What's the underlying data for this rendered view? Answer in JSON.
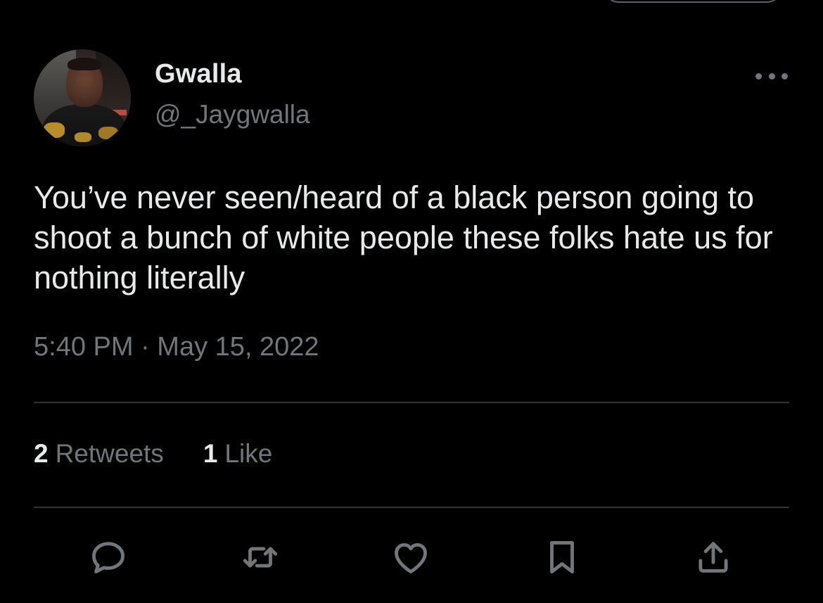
{
  "tweet": {
    "author": {
      "display_name": "Gwalla",
      "handle": "@_Jaygwalla"
    },
    "text": "You’ve never seen/heard of a black person going to shoot a bunch of white people these folks hate us for nothing literally",
    "timestamp": "5:40 PM · May 15, 2022",
    "stats": {
      "retweets_count": "2",
      "retweets_label": "Retweets",
      "likes_count": "1",
      "likes_label": "Like"
    },
    "actions": [
      {
        "name": "reply",
        "icon": "reply-icon"
      },
      {
        "name": "retweet",
        "icon": "retweet-icon"
      },
      {
        "name": "like",
        "icon": "heart-icon"
      },
      {
        "name": "bookmark",
        "icon": "bookmark-icon"
      },
      {
        "name": "share",
        "icon": "share-icon"
      }
    ]
  },
  "colors": {
    "background": "#000000",
    "text_primary": "#e7e9ea",
    "text_secondary": "#71767b",
    "divider": "#2f3336"
  }
}
